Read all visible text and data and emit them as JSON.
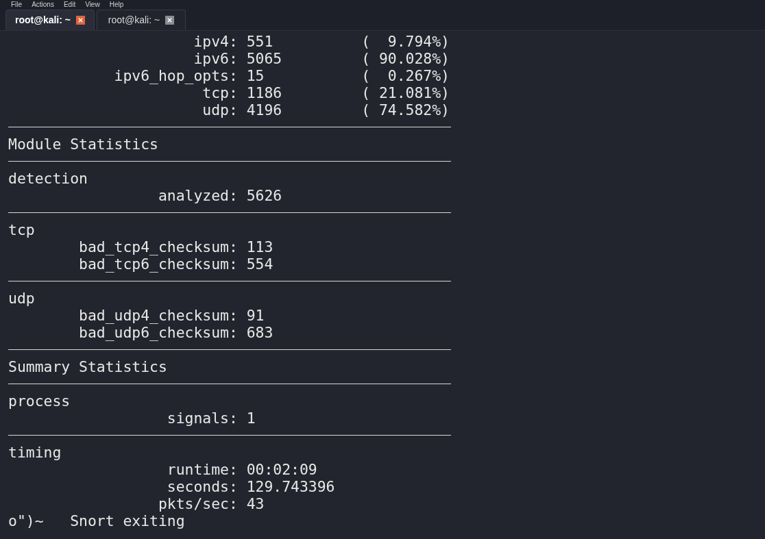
{
  "menu": [
    "File",
    "Actions",
    "Edit",
    "View",
    "Help"
  ],
  "tabs": [
    {
      "label": "root@kali: ~",
      "selected": true
    },
    {
      "label": "root@kali: ~",
      "selected": false
    }
  ],
  "terminal_lines": [
    {
      "kind": "text",
      "text": "                     ipv4: 551          (  9.794%)"
    },
    {
      "kind": "text",
      "text": "                     ipv6: 5065         ( 90.028%)"
    },
    {
      "kind": "text",
      "text": "            ipv6_hop_opts: 15           (  0.267%)"
    },
    {
      "kind": "text",
      "text": "                      tcp: 1186         ( 21.081%)"
    },
    {
      "kind": "text",
      "text": "                      udp: 4196         ( 74.582%)"
    },
    {
      "kind": "rule"
    },
    {
      "kind": "text",
      "text": "Module Statistics"
    },
    {
      "kind": "rule"
    },
    {
      "kind": "text",
      "text": "detection"
    },
    {
      "kind": "text",
      "text": "                 analyzed: 5626"
    },
    {
      "kind": "rule"
    },
    {
      "kind": "text",
      "text": "tcp"
    },
    {
      "kind": "text",
      "text": "        bad_tcp4_checksum: 113"
    },
    {
      "kind": "text",
      "text": "        bad_tcp6_checksum: 554"
    },
    {
      "kind": "rule"
    },
    {
      "kind": "text",
      "text": "udp"
    },
    {
      "kind": "text",
      "text": "        bad_udp4_checksum: 91"
    },
    {
      "kind": "text",
      "text": "        bad_udp6_checksum: 683"
    },
    {
      "kind": "rule"
    },
    {
      "kind": "text",
      "text": "Summary Statistics"
    },
    {
      "kind": "rule"
    },
    {
      "kind": "text",
      "text": "process"
    },
    {
      "kind": "text",
      "text": "                  signals: 1"
    },
    {
      "kind": "rule"
    },
    {
      "kind": "text",
      "text": "timing"
    },
    {
      "kind": "text",
      "text": "                  runtime: 00:02:09"
    },
    {
      "kind": "text",
      "text": "                  seconds: 129.743396"
    },
    {
      "kind": "text",
      "text": "                 pkts/sec: 43"
    },
    {
      "kind": "text",
      "text": "o\")~   Snort exiting"
    }
  ]
}
